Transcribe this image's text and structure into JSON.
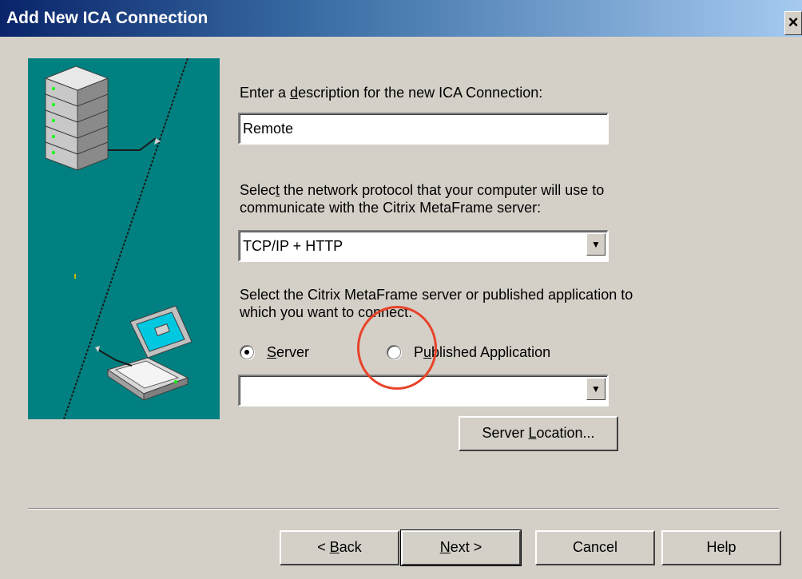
{
  "window": {
    "title": "Add New ICA Connection",
    "close_label": "×"
  },
  "description": {
    "label_pre": "Enter a ",
    "label_accel": "d",
    "label_post": "escription for the new ICA Connection:",
    "value": "Remote"
  },
  "protocol": {
    "label_line1_pre": "Selec",
    "label_line1_accel": "t",
    "label_line1_post": " the network protocol that your computer will use to",
    "label_line2": "communicate with the Citrix MetaFrame server:",
    "selected": "TCP/IP + HTTP"
  },
  "target": {
    "label_line1": "Select the Citrix MetaFrame server or published application to",
    "label_line2": "which you want to connect:",
    "radio_server_accel": "S",
    "radio_server_rest": "erver",
    "radio_server_checked": true,
    "radio_app_pre": "P",
    "radio_app_accel": "u",
    "radio_app_post": "blished Application",
    "radio_app_checked": false,
    "combo_value": ""
  },
  "server_location_button": {
    "pre": "Server ",
    "accel": "L",
    "post": "ocation..."
  },
  "footer": {
    "back_pre": "< ",
    "back_accel": "B",
    "back_post": "ack",
    "next_accel": "N",
    "next_post": "ext >",
    "cancel": "Cancel",
    "help": "Help"
  },
  "colors": {
    "title_gradient_start": "#0a246a",
    "title_gradient_end": "#a6caf0",
    "dialog_bg": "#d4d0c8",
    "art_bg": "#008080",
    "highlight": "#e8432a"
  },
  "icons": [
    "server-stack-icon",
    "laptop-icon",
    "close-icon",
    "dropdown-arrow-icon"
  ]
}
